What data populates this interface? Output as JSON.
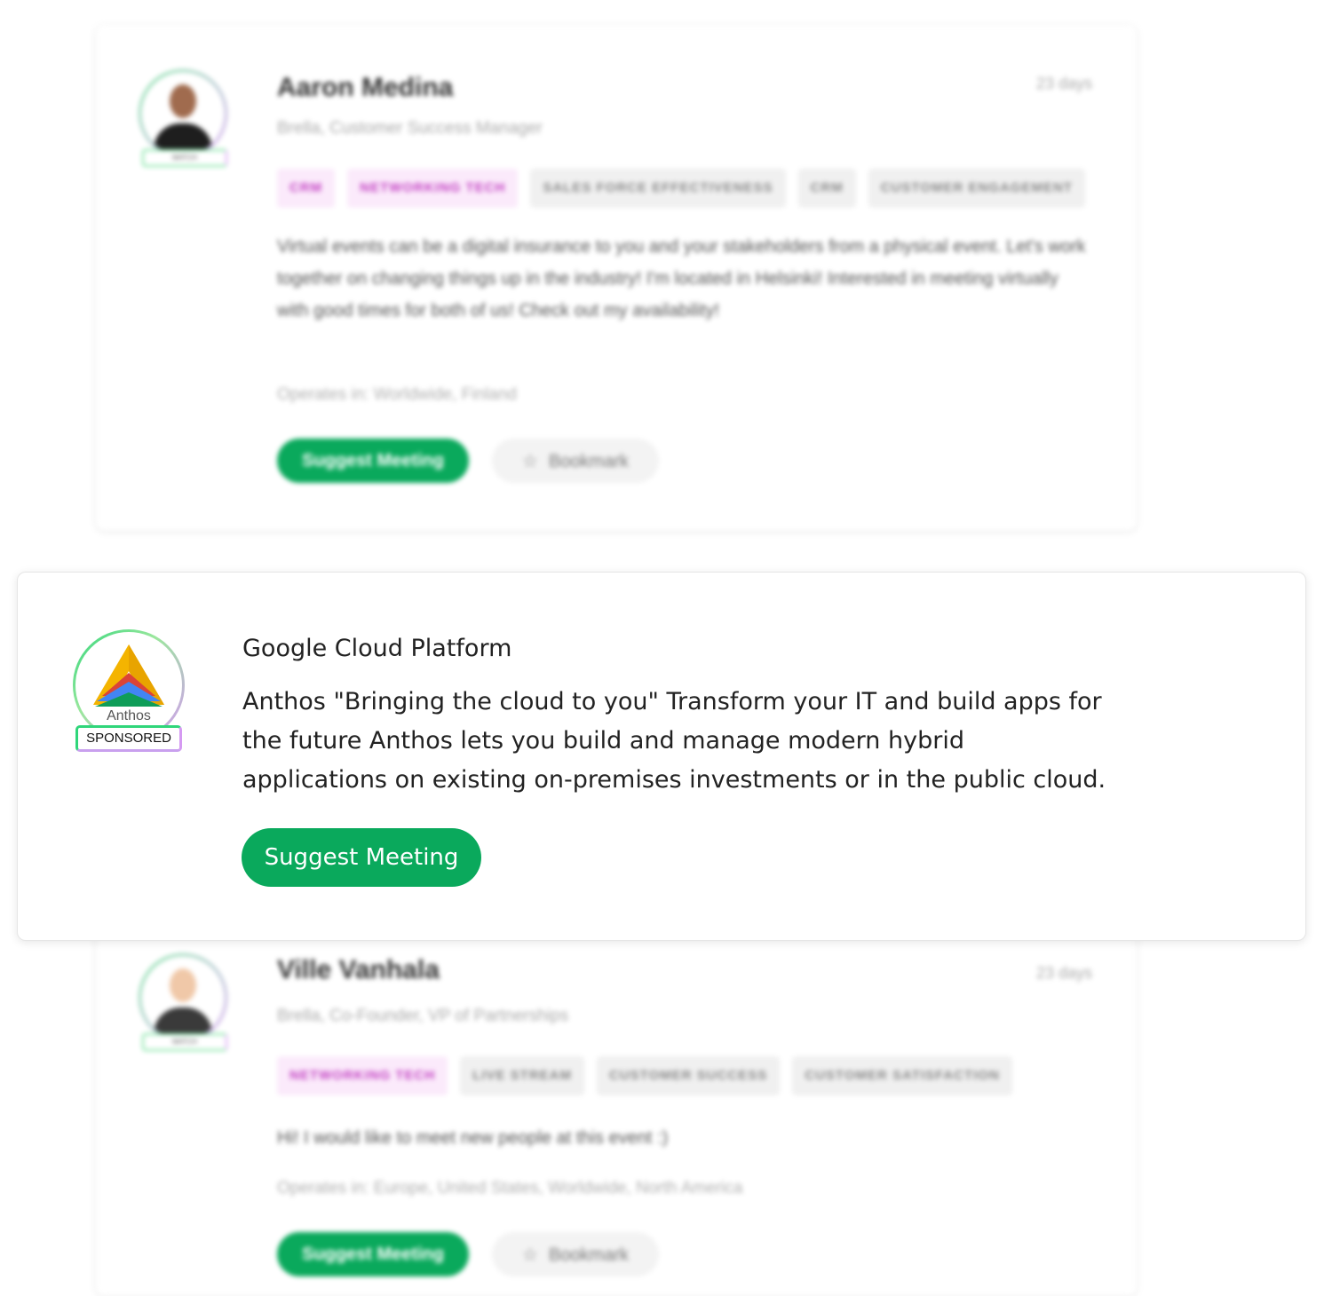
{
  "profiles": [
    {
      "name": "Aaron Medina",
      "time": "23 days",
      "role": "Brella, Customer Success Manager",
      "badge": "MATCH",
      "tags": [
        {
          "label": "CRM",
          "highlight": true
        },
        {
          "label": "NETWORKING TECH",
          "highlight": true
        },
        {
          "label": "SALES FORCE EFFECTIVENESS",
          "highlight": false
        },
        {
          "label": "CRM",
          "highlight": false
        },
        {
          "label": "CUSTOMER ENGAGEMENT",
          "highlight": false
        }
      ],
      "bio": "Virtual events can be a digital insurance to you and your stakeholders from a physical event. Let's work together on changing things up in the industry! I'm located in Helsinki! Interested in meeting virtually with good times for both of us! Check out my availability!",
      "operates": "Operates in: Worldwide, Finland",
      "suggest_label": "Suggest Meeting",
      "bookmark_label": "Bookmark"
    },
    {
      "name": "Ville Vanhala",
      "time": "23 days",
      "role": "Brella, Co-Founder, VP of Partnerships",
      "badge": "MATCH",
      "tags": [
        {
          "label": "NETWORKING TECH",
          "highlight": true
        },
        {
          "label": "LIVE STREAM",
          "highlight": false
        },
        {
          "label": "CUSTOMER SUCCESS",
          "highlight": false
        },
        {
          "label": "CUSTOMER SATISFACTION",
          "highlight": false
        }
      ],
      "bio": "Hi! I would like to meet new people at this event :)",
      "operates": "Operates in: Europe, United States, Worldwide, North America",
      "suggest_label": "Suggest Meeting",
      "bookmark_label": "Bookmark"
    }
  ],
  "sponsored": {
    "logo_text": "Anthos",
    "badge": "SPONSORED",
    "title": "Google Cloud Platform",
    "description": "Anthos \"Bringing the cloud to you\" Transform your IT and build apps for the future Anthos lets you build and manage modern hybrid applications on existing on-premises investments or in the public cloud.",
    "button_label": "Suggest Meeting"
  },
  "colors": {
    "primary_green": "#0aa95c",
    "tag_highlight_bg": "#fbeafb",
    "tag_highlight_text": "#c23fc2",
    "tag_bg": "#f0f0f0"
  },
  "icons": {
    "bookmark": "star-outline-icon",
    "logo": "anthos-logo-icon"
  }
}
